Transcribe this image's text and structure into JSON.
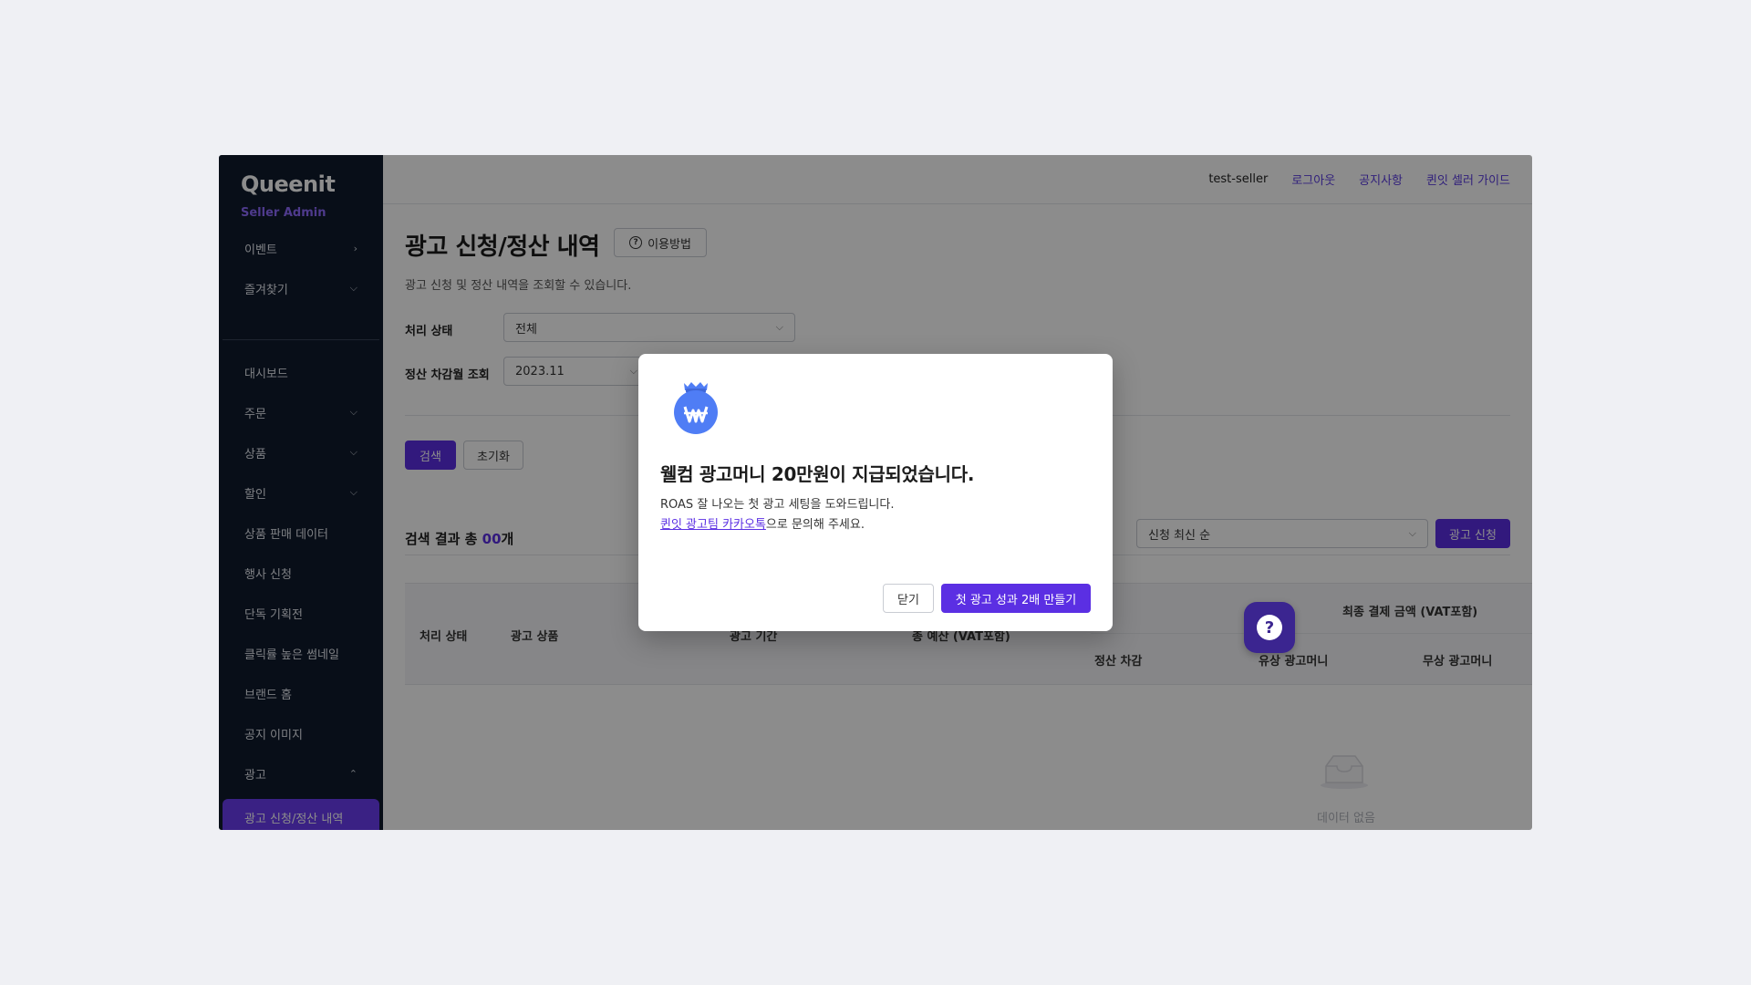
{
  "sidebar": {
    "brand": "Queenit",
    "brand_sub": "Seller Admin",
    "top_items": [
      {
        "label": "이벤트",
        "chevron": ">"
      },
      {
        "label": "즐겨찾기",
        "chevron": "v"
      }
    ],
    "items": [
      {
        "label": "대시보드"
      },
      {
        "label": "주문"
      },
      {
        "label": "상품"
      },
      {
        "label": "할인"
      },
      {
        "label": "상품 판매 데이터"
      },
      {
        "label": "행사 신청"
      },
      {
        "label": "단독 기획전"
      },
      {
        "label": "클릭률 높은 썸네일"
      },
      {
        "label": "브랜드 홈"
      },
      {
        "label": "공지 이미지"
      },
      {
        "label": "광고"
      },
      {
        "label": "광고 신청/정산 내역"
      }
    ]
  },
  "header": {
    "user": "test-seller",
    "logout": "로그아웃",
    "notice": "공지사항",
    "guide": "퀸잇 셀러 가이드"
  },
  "page": {
    "title": "광고 신청/정산 내역",
    "help_label": "이용방법",
    "description": "광고 신청 및 정산 내역을 조회할 수 있습니다."
  },
  "filters": {
    "status_label": "처리 상태",
    "status_value": "전체",
    "month_label": "정산 차감월 조회",
    "month_value": "2023.11",
    "search_button": "검색",
    "reset_button": "초기화"
  },
  "results": {
    "prefix": "검색 결과 총 ",
    "count": "00",
    "suffix": "개",
    "sort_value": "신청 최신 순",
    "apply_button": "광고 신청"
  },
  "table": {
    "headers": {
      "status": "처리 상태",
      "product": "광고 상품",
      "period": "광고 기간",
      "budget": "총 예산 (VAT포함)",
      "final_amount": "최종 결제 금액 (VAT포함)",
      "settlement": "정산 차감",
      "paid_money": "유상 광고머니",
      "free_money": "무상 광고머니"
    },
    "empty_text": "데이터 없음"
  },
  "modal": {
    "title": "웰컴 광고머니 20만원이 지급되었습니다.",
    "body1": "ROAS 잘 나오는 첫 광고 세팅을 도와드립니다.",
    "body2_link": "퀸잇 광고팀 카카오톡",
    "body2_rest": "으로 문의해 주세요.",
    "close_button": "닫기",
    "cta_button": "첫 광고 성과 2배 만들기"
  },
  "colors": {
    "sidebar_bg": "#0f1a2c",
    "accent": "#5b2fe3",
    "brand_sub": "#8f6bff",
    "icon_blue": "#4f7df5"
  },
  "icons": {
    "money_bag": "money-bag-won-icon",
    "help": "question-circle-icon",
    "empty": "empty-inbox-icon",
    "fab": "help-chat-icon"
  }
}
